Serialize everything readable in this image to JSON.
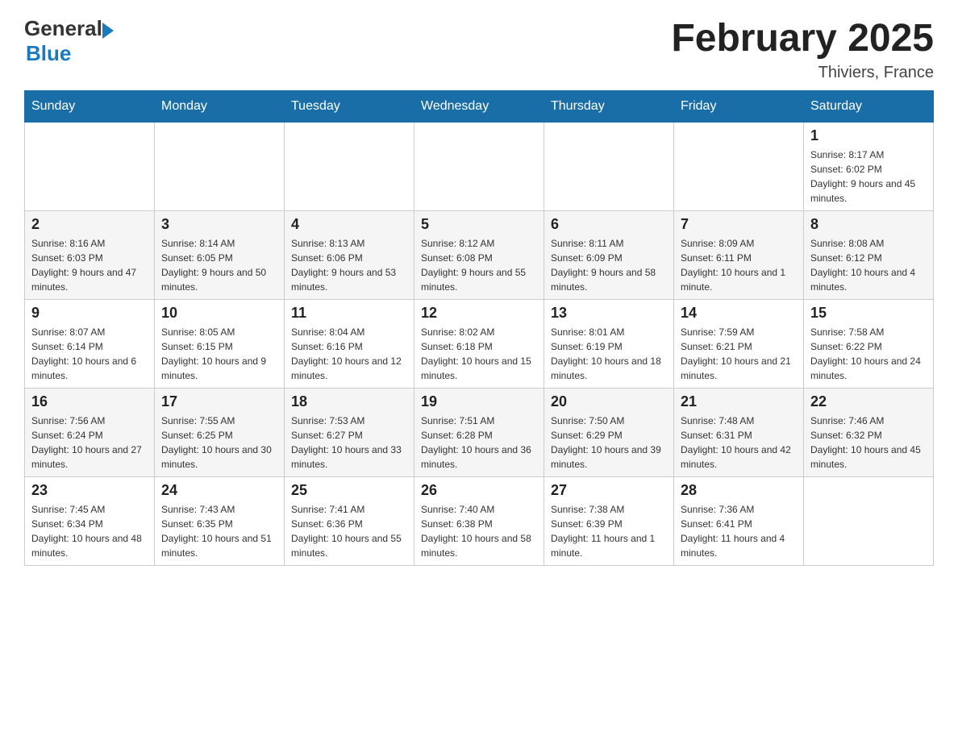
{
  "header": {
    "logo_general": "General",
    "logo_blue": "Blue",
    "month_year": "February 2025",
    "location": "Thiviers, France"
  },
  "days_of_week": [
    "Sunday",
    "Monday",
    "Tuesday",
    "Wednesday",
    "Thursday",
    "Friday",
    "Saturday"
  ],
  "weeks": [
    [
      {
        "day": "",
        "info": ""
      },
      {
        "day": "",
        "info": ""
      },
      {
        "day": "",
        "info": ""
      },
      {
        "day": "",
        "info": ""
      },
      {
        "day": "",
        "info": ""
      },
      {
        "day": "",
        "info": ""
      },
      {
        "day": "1",
        "info": "Sunrise: 8:17 AM\nSunset: 6:02 PM\nDaylight: 9 hours and 45 minutes."
      }
    ],
    [
      {
        "day": "2",
        "info": "Sunrise: 8:16 AM\nSunset: 6:03 PM\nDaylight: 9 hours and 47 minutes."
      },
      {
        "day": "3",
        "info": "Sunrise: 8:14 AM\nSunset: 6:05 PM\nDaylight: 9 hours and 50 minutes."
      },
      {
        "day": "4",
        "info": "Sunrise: 8:13 AM\nSunset: 6:06 PM\nDaylight: 9 hours and 53 minutes."
      },
      {
        "day": "5",
        "info": "Sunrise: 8:12 AM\nSunset: 6:08 PM\nDaylight: 9 hours and 55 minutes."
      },
      {
        "day": "6",
        "info": "Sunrise: 8:11 AM\nSunset: 6:09 PM\nDaylight: 9 hours and 58 minutes."
      },
      {
        "day": "7",
        "info": "Sunrise: 8:09 AM\nSunset: 6:11 PM\nDaylight: 10 hours and 1 minute."
      },
      {
        "day": "8",
        "info": "Sunrise: 8:08 AM\nSunset: 6:12 PM\nDaylight: 10 hours and 4 minutes."
      }
    ],
    [
      {
        "day": "9",
        "info": "Sunrise: 8:07 AM\nSunset: 6:14 PM\nDaylight: 10 hours and 6 minutes."
      },
      {
        "day": "10",
        "info": "Sunrise: 8:05 AM\nSunset: 6:15 PM\nDaylight: 10 hours and 9 minutes."
      },
      {
        "day": "11",
        "info": "Sunrise: 8:04 AM\nSunset: 6:16 PM\nDaylight: 10 hours and 12 minutes."
      },
      {
        "day": "12",
        "info": "Sunrise: 8:02 AM\nSunset: 6:18 PM\nDaylight: 10 hours and 15 minutes."
      },
      {
        "day": "13",
        "info": "Sunrise: 8:01 AM\nSunset: 6:19 PM\nDaylight: 10 hours and 18 minutes."
      },
      {
        "day": "14",
        "info": "Sunrise: 7:59 AM\nSunset: 6:21 PM\nDaylight: 10 hours and 21 minutes."
      },
      {
        "day": "15",
        "info": "Sunrise: 7:58 AM\nSunset: 6:22 PM\nDaylight: 10 hours and 24 minutes."
      }
    ],
    [
      {
        "day": "16",
        "info": "Sunrise: 7:56 AM\nSunset: 6:24 PM\nDaylight: 10 hours and 27 minutes."
      },
      {
        "day": "17",
        "info": "Sunrise: 7:55 AM\nSunset: 6:25 PM\nDaylight: 10 hours and 30 minutes."
      },
      {
        "day": "18",
        "info": "Sunrise: 7:53 AM\nSunset: 6:27 PM\nDaylight: 10 hours and 33 minutes."
      },
      {
        "day": "19",
        "info": "Sunrise: 7:51 AM\nSunset: 6:28 PM\nDaylight: 10 hours and 36 minutes."
      },
      {
        "day": "20",
        "info": "Sunrise: 7:50 AM\nSunset: 6:29 PM\nDaylight: 10 hours and 39 minutes."
      },
      {
        "day": "21",
        "info": "Sunrise: 7:48 AM\nSunset: 6:31 PM\nDaylight: 10 hours and 42 minutes."
      },
      {
        "day": "22",
        "info": "Sunrise: 7:46 AM\nSunset: 6:32 PM\nDaylight: 10 hours and 45 minutes."
      }
    ],
    [
      {
        "day": "23",
        "info": "Sunrise: 7:45 AM\nSunset: 6:34 PM\nDaylight: 10 hours and 48 minutes."
      },
      {
        "day": "24",
        "info": "Sunrise: 7:43 AM\nSunset: 6:35 PM\nDaylight: 10 hours and 51 minutes."
      },
      {
        "day": "25",
        "info": "Sunrise: 7:41 AM\nSunset: 6:36 PM\nDaylight: 10 hours and 55 minutes."
      },
      {
        "day": "26",
        "info": "Sunrise: 7:40 AM\nSunset: 6:38 PM\nDaylight: 10 hours and 58 minutes."
      },
      {
        "day": "27",
        "info": "Sunrise: 7:38 AM\nSunset: 6:39 PM\nDaylight: 11 hours and 1 minute."
      },
      {
        "day": "28",
        "info": "Sunrise: 7:36 AM\nSunset: 6:41 PM\nDaylight: 11 hours and 4 minutes."
      },
      {
        "day": "",
        "info": ""
      }
    ]
  ]
}
